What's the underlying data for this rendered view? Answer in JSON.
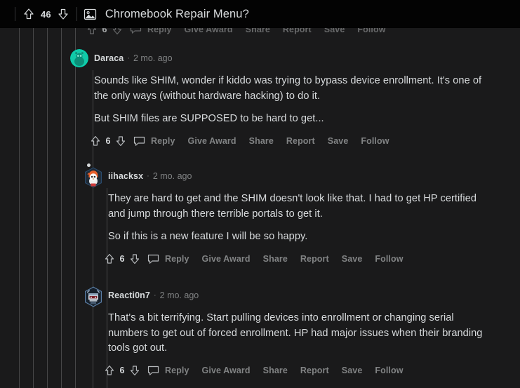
{
  "header": {
    "score": "46",
    "upvote_icon": "upvote-arrow-icon",
    "downvote_icon": "downvote-arrow-icon",
    "thumbnail_icon": "image-thumbnail-icon",
    "title": "Chromebook Repair Menu?"
  },
  "action_labels": {
    "reply": "Reply",
    "give_award": "Give Award",
    "share": "Share",
    "report": "Report",
    "save": "Save",
    "follow": "Follow"
  },
  "clipped_comment": {
    "score": "6"
  },
  "comments": [
    {
      "username": "Daraca",
      "separator": "·",
      "timestamp": "2 mo. ago",
      "avatar": "teal-snoo-avatar",
      "paragraphs": [
        "Sounds like SHIM, wonder if kiddo was trying to bypass device enrollment. It's one of the only ways (without hardware hacking) to do it.",
        "But SHIM files are SUPPOSED to be hard to get..."
      ],
      "score": "6"
    },
    {
      "username": "iihacksx",
      "separator": "·",
      "timestamp": "2 mo. ago",
      "avatar": "orange-hood-snoo-avatar",
      "paragraphs": [
        "They are hard to get and the SHIM doesn't look like that. I had to get HP certified and jump through there terrible portals to get it.",
        "So if this is a new feature I will be so happy."
      ],
      "score": "6"
    },
    {
      "username": "Reacti0n7",
      "separator": "·",
      "timestamp": "2 mo. ago",
      "avatar": "blue-robot-snoo-avatar",
      "paragraphs": [
        "That's a bit terrifying. Start pulling devices into enrollment or changing serial numbers to get out of forced enrollment. HP had major issues when their branding tools got out."
      ],
      "score": "6"
    }
  ],
  "colors": {
    "header_bg": "#030303",
    "page_bg": "#1a1a1b",
    "text_primary": "#d7dadc",
    "text_muted": "#818384",
    "threadline": "#474748"
  }
}
